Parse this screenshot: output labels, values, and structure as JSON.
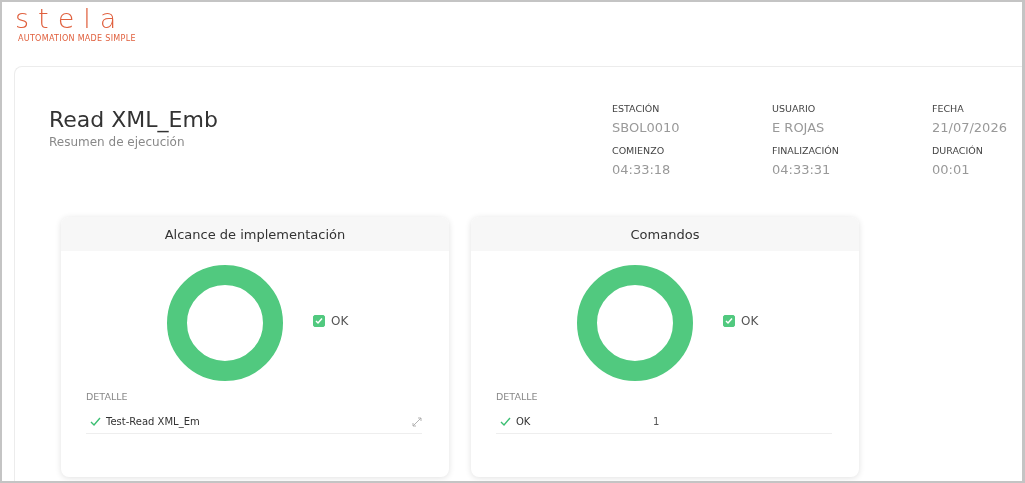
{
  "logo": {
    "name": "stela",
    "tagline": "AUTOMATION MADE SIMPLE"
  },
  "header": {
    "title": "Read XML_Emb",
    "subtitle": "Resumen de ejecución"
  },
  "meta": [
    {
      "label": "ESTACIÓN",
      "value": "SBOL0010"
    },
    {
      "label": "USUARIO",
      "value": "E ROJAS"
    },
    {
      "label": "FECHA",
      "value": "21/07/2026"
    },
    {
      "label": "COMIENZO",
      "value": "04:33:18"
    },
    {
      "label": "FINALIZACIÓN",
      "value": "04:33:31"
    },
    {
      "label": "DURACIÓN",
      "value": "00:01"
    }
  ],
  "panels": [
    {
      "title": "Alcance de implementación",
      "legend": {
        "label": "OK",
        "checked": true,
        "color": "#51c97f"
      },
      "detail_label": "DETALLE",
      "rows": [
        {
          "kind": "expandable",
          "name": "Test-Read XML_Em"
        }
      ]
    },
    {
      "title": "Comandos",
      "legend": {
        "label": "OK",
        "checked": true,
        "color": "#51c97f"
      },
      "detail_label": "DETALLE",
      "rows": [
        {
          "kind": "count",
          "name": "OK",
          "count": "1"
        }
      ]
    }
  ]
}
